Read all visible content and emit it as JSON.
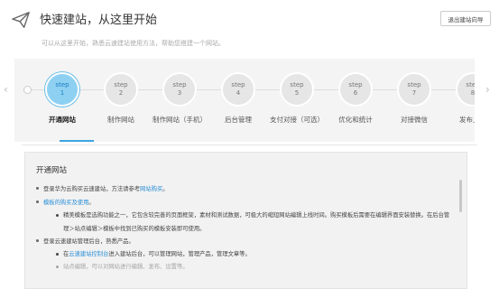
{
  "header": {
    "title": "快速建站，从这里开始",
    "subtitle": "可以从这里开始，熟悉云速建站使用方法，帮助您搭建一个网站。",
    "exit_label": "退出建站向导",
    "icon": "paper-plane-icon"
  },
  "steps": [
    {
      "word": "step",
      "num": "1",
      "label": "开通网站",
      "active": true
    },
    {
      "word": "step",
      "num": "2",
      "label": "制作网站",
      "active": false
    },
    {
      "word": "step",
      "num": "3",
      "label": "制作网站（手机）",
      "active": false
    },
    {
      "word": "step",
      "num": "4",
      "label": "后台管理",
      "active": false
    },
    {
      "word": "step",
      "num": "5",
      "label": "支付对接（可选）",
      "active": false
    },
    {
      "word": "step",
      "num": "6",
      "label": "优化和统计",
      "active": false
    },
    {
      "word": "step",
      "num": "7",
      "label": "对接微信",
      "active": false
    },
    {
      "word": "step",
      "num": "8",
      "label": "发布上线",
      "active": false
    }
  ],
  "colors": {
    "active_step": "#8ed0f2",
    "link": "#2a8fd6",
    "underline": "#3ca5e0"
  },
  "panel": {
    "title": "开通网站",
    "item1_pre": "登录华为云购买云速建站，方法请参考",
    "item1_link": "网站购买",
    "item1_post": "。",
    "item2_link": "模板的购买及使用",
    "item2_post": "。",
    "item2_sub1": "精美模板是选购功能之一，它包含较完善的页面框架，素材和测试数据，可极大的缩短网站编辑上线时间。购买模板后需要在编辑界面安装替换。在后台管",
    "item2_sub2": "理＞站点编辑＞模板中找到已购买的模板安装即可使用。",
    "item3": "登录云速建站管理后台，熟悉产品。",
    "item3_sub_pre": "在",
    "item3_sub_link": "云速建站控制台",
    "item3_sub_post": "进入建站后台，可以管理网站，管理产品，管理文章等。",
    "item3_sub2": "站点编辑，可以对网站进行编辑、发布、设置等。"
  }
}
